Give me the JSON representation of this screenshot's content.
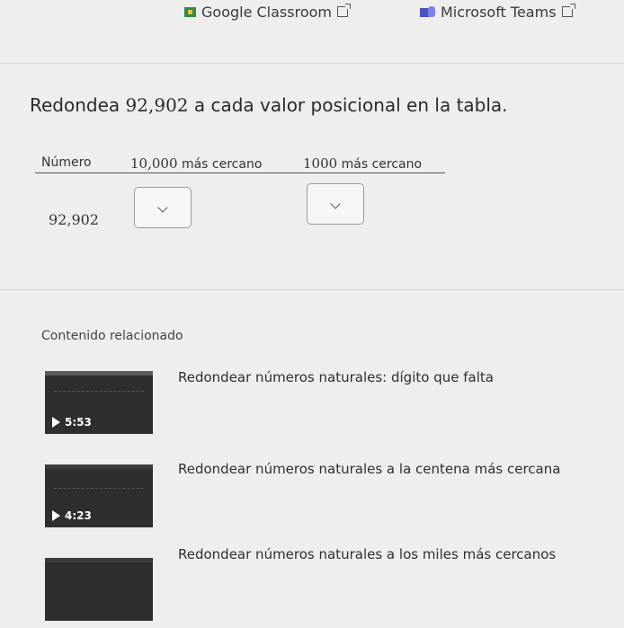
{
  "share": {
    "google_classroom": "Google Classroom",
    "microsoft_teams": "Microsoft Teams"
  },
  "question": {
    "prompt_before": "Redondea ",
    "number": "92,902",
    "prompt_after": " a cada valor posicional en la tabla."
  },
  "table": {
    "col_number": "Número",
    "col_ten_thousand_value": "10,000",
    "col_ten_thousand_suffix": " más cercano",
    "col_thousand_value": "1000",
    "col_thousand_suffix": " más cercano",
    "row_value": "92,902"
  },
  "related": {
    "heading": "Contenido relacionado",
    "videos": [
      {
        "title": "Redondear números naturales: dígito que falta",
        "duration": "5:53"
      },
      {
        "title": "Redondear números naturales a la centena más cercana",
        "duration": "4:23"
      },
      {
        "title": "Redondear números naturales a los miles más cercanos",
        "duration": ""
      }
    ]
  },
  "colors": {
    "background": "#eeeeec",
    "google_classroom_icon": "#2e8b4a",
    "teams_icon": "#4b53bc"
  }
}
